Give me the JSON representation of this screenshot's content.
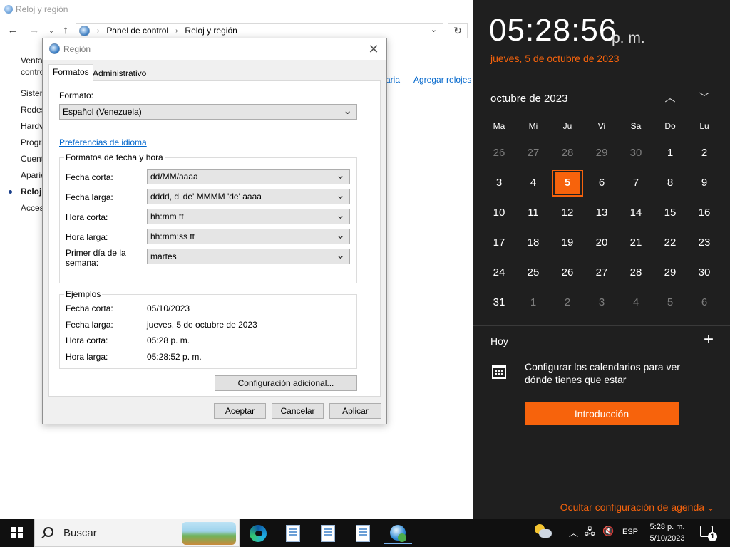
{
  "control_panel": {
    "window_title": "Reloj y región",
    "breadcrumb": [
      "Panel de control",
      "Reloj y región"
    ],
    "sidebar": [
      "Venta",
      "contro",
      "Sisten",
      "Redes",
      "Hardv",
      "Progra",
      "Cuent",
      "Aparie",
      "Reloj",
      "Acces"
    ],
    "links": [
      "aria",
      "Agregar relojes"
    ]
  },
  "dialog": {
    "title": "Región",
    "tabs": [
      {
        "label": "Formatos",
        "active": true
      },
      {
        "label": "Administrativo",
        "active": false
      }
    ],
    "format_label": "Formato:",
    "format_value": "Español (Venezuela)",
    "language_prefs_link": "Preferencias de idioma",
    "date_time_group": {
      "title": "Formatos de fecha y hora",
      "rows": [
        {
          "label": "Fecha corta:",
          "value": "dd/MM/aaaa"
        },
        {
          "label": "Fecha larga:",
          "value": "dddd, d 'de' MMMM 'de' aaaa"
        },
        {
          "label": "Hora corta:",
          "value": "hh:mm tt"
        },
        {
          "label": "Hora larga:",
          "value": "hh:mm:ss tt"
        },
        {
          "label": "Primer día de la semana:",
          "value": "martes"
        }
      ]
    },
    "examples_group": {
      "title": "Ejemplos",
      "rows": [
        {
          "label": "Fecha corta:",
          "value": "05/10/2023"
        },
        {
          "label": "Fecha larga:",
          "value": "jueves, 5 de octubre de 2023"
        },
        {
          "label": "Hora corta:",
          "value": "05:28 p. m."
        },
        {
          "label": "Hora larga:",
          "value": "05:28:52 p. m."
        }
      ]
    },
    "additional_settings": "Configuración adicional...",
    "buttons": {
      "ok": "Aceptar",
      "cancel": "Cancelar",
      "apply": "Aplicar"
    }
  },
  "flyout": {
    "time": "05:28:56",
    "ampm": "p. m.",
    "date": "jueves, 5 de octubre de 2023",
    "month_label": "octubre de 2023",
    "weekdays": [
      "Ma",
      "Mi",
      "Ju",
      "Vi",
      "Sa",
      "Do",
      "Lu"
    ],
    "weeks": [
      [
        {
          "d": "26",
          "dim": true
        },
        {
          "d": "27",
          "dim": true
        },
        {
          "d": "28",
          "dim": true
        },
        {
          "d": "29",
          "dim": true
        },
        {
          "d": "30",
          "dim": true
        },
        {
          "d": "1"
        },
        {
          "d": "2"
        }
      ],
      [
        {
          "d": "3"
        },
        {
          "d": "4"
        },
        {
          "d": "5",
          "today": true
        },
        {
          "d": "6"
        },
        {
          "d": "7"
        },
        {
          "d": "8"
        },
        {
          "d": "9"
        }
      ],
      [
        {
          "d": "10"
        },
        {
          "d": "11"
        },
        {
          "d": "12"
        },
        {
          "d": "13"
        },
        {
          "d": "14"
        },
        {
          "d": "15"
        },
        {
          "d": "16"
        }
      ],
      [
        {
          "d": "17"
        },
        {
          "d": "18"
        },
        {
          "d": "19"
        },
        {
          "d": "20"
        },
        {
          "d": "21"
        },
        {
          "d": "22"
        },
        {
          "d": "23"
        }
      ],
      [
        {
          "d": "24"
        },
        {
          "d": "25"
        },
        {
          "d": "26"
        },
        {
          "d": "27"
        },
        {
          "d": "28"
        },
        {
          "d": "29"
        },
        {
          "d": "30"
        }
      ],
      [
        {
          "d": "31"
        },
        {
          "d": "1",
          "dim": true
        },
        {
          "d": "2",
          "dim": true
        },
        {
          "d": "3",
          "dim": true
        },
        {
          "d": "4",
          "dim": true
        },
        {
          "d": "5",
          "dim": true
        },
        {
          "d": "6",
          "dim": true
        }
      ]
    ],
    "today_label": "Hoy",
    "agenda_message": "Configurar los calendarios para ver dónde tienes que estar",
    "intro_button": "Introducción",
    "hide_agenda": "Ocultar configuración de agenda",
    "accent_color": "#f7630c"
  },
  "taskbar": {
    "search_text": "Buscar",
    "language": "ESP",
    "clock_time": "5:28 p. m.",
    "clock_date": "5/10/2023",
    "notification_count": "1"
  }
}
